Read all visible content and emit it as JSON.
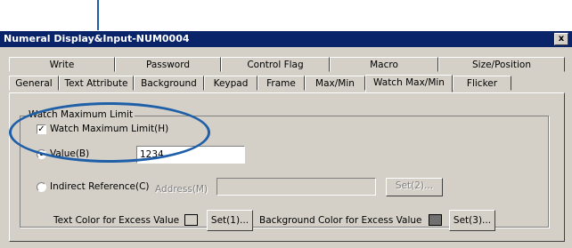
{
  "window": {
    "title": "Numeral Display&Input-NUM0004",
    "close_label": "x"
  },
  "tabs_row_back": [
    "Write",
    "Password",
    "Control Flag",
    "Macro",
    "Size/Position"
  ],
  "tabs_row_front": [
    "General",
    "Text Attribute",
    "Background",
    "Keypad",
    "Frame",
    "Max/Min",
    "Watch Max/Min",
    "Flicker"
  ],
  "selected_tab": "Watch Max/Min",
  "group": {
    "title": "Watch Maximum Limit",
    "watch_checkbox_label": "Watch Maximum Limit(H)",
    "watch_checked": true,
    "value_radio_label": "Value(B)",
    "value_input": "1234",
    "indirect_radio_label": "Indirect Reference(C)",
    "address_label": "Address(M)",
    "address_input": "",
    "set_address_button": "Set(2)...",
    "text_color_label": "Text Color for Excess Value",
    "text_color_swatch": "#d4d0c8",
    "set_text_color_button": "Set(1)...",
    "bg_color_label": "Background Color for Excess Value",
    "bg_color_swatch": "#707070",
    "set_bg_color_button": "Set(3)..."
  },
  "colors": {
    "annotation": "#1f5fa8",
    "titlebar": "#0a246a"
  }
}
